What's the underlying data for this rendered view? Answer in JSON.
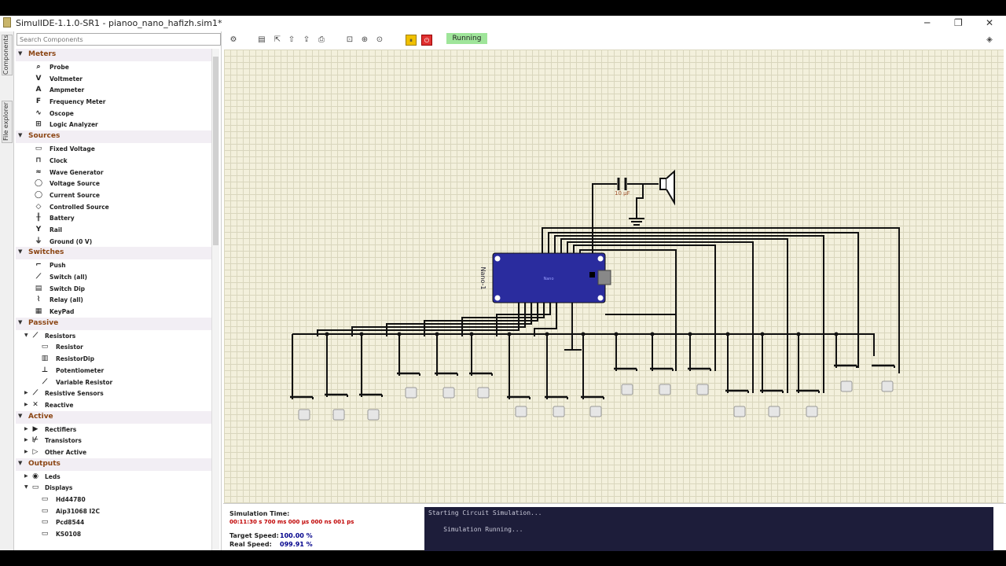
{
  "window": {
    "title": "SimulIDE-1.1.0-SR1 - pianoo_nano_hafizh.sim1*"
  },
  "left_tabs": [
    "Components",
    "File explorer"
  ],
  "search": {
    "placeholder": "Search Components"
  },
  "tree": [
    {
      "category": "Meters",
      "items": [
        {
          "label": "Probe",
          "icon": "probe-icon",
          "glyph": "⌕"
        },
        {
          "label": "Voltmeter",
          "icon": "voltmeter-icon",
          "glyph": "V"
        },
        {
          "label": "Ampmeter",
          "icon": "ampmeter-icon",
          "glyph": "A"
        },
        {
          "label": "Frequency Meter",
          "icon": "frequency-meter-icon",
          "glyph": "F"
        },
        {
          "label": "Oscope",
          "icon": "oscope-icon",
          "glyph": "∿"
        },
        {
          "label": "Logic Analyzer",
          "icon": "logic-analyzer-icon",
          "glyph": "⊞"
        }
      ]
    },
    {
      "category": "Sources",
      "items": [
        {
          "label": "Fixed Voltage",
          "icon": "fixed-voltage-icon",
          "glyph": "▭"
        },
        {
          "label": "Clock",
          "icon": "clock-icon",
          "glyph": "⊓"
        },
        {
          "label": "Wave Generator",
          "icon": "wave-generator-icon",
          "glyph": "≈"
        },
        {
          "label": "Voltage Source",
          "icon": "voltage-source-icon",
          "glyph": "◯"
        },
        {
          "label": "Current Source",
          "icon": "current-source-icon",
          "glyph": "◯"
        },
        {
          "label": "Controlled Source",
          "icon": "controlled-source-icon",
          "glyph": "◇"
        },
        {
          "label": "Battery",
          "icon": "battery-icon",
          "glyph": "╫"
        },
        {
          "label": "Rail",
          "icon": "rail-icon",
          "glyph": "Y"
        },
        {
          "label": "Ground (0 V)",
          "icon": "ground-icon",
          "glyph": "⏚"
        }
      ]
    },
    {
      "category": "Switches",
      "items": [
        {
          "label": "Push",
          "icon": "push-icon",
          "glyph": "⌐"
        },
        {
          "label": "Switch (all)",
          "icon": "switch-icon",
          "glyph": "⟋"
        },
        {
          "label": "Switch Dip",
          "icon": "switch-dip-icon",
          "glyph": "▤"
        },
        {
          "label": "Relay (all)",
          "icon": "relay-icon",
          "glyph": "⌇"
        },
        {
          "label": "KeyPad",
          "icon": "keypad-icon",
          "glyph": "▦"
        }
      ]
    },
    {
      "category": "Passive",
      "items": [
        {
          "label": "Resistors",
          "icon": "resistors-icon",
          "glyph": "⟋",
          "level": "sub",
          "arrow": "▼"
        },
        {
          "label": "Resistor",
          "icon": "resistor-icon",
          "glyph": "▭",
          "level": "sub2"
        },
        {
          "label": "ResistorDip",
          "icon": "resistor-dip-icon",
          "glyph": "▥",
          "level": "sub2"
        },
        {
          "label": "Potentiometer",
          "icon": "potentiometer-icon",
          "glyph": "⊥",
          "level": "sub2"
        },
        {
          "label": "Variable Resistor",
          "icon": "variable-resistor-icon",
          "glyph": "⟋",
          "level": "sub2"
        },
        {
          "label": "Resistive Sensors",
          "icon": "resistive-sensors-icon",
          "glyph": "⟋",
          "level": "sub",
          "arrow": "▶"
        },
        {
          "label": "Reactive",
          "icon": "reactive-icon",
          "glyph": "✕",
          "level": "sub",
          "arrow": "▶"
        }
      ]
    },
    {
      "category": "Active",
      "items": [
        {
          "label": "Rectifiers",
          "icon": "rectifiers-icon",
          "glyph": "▶",
          "level": "sub",
          "arrow": "▶"
        },
        {
          "label": "Transistors",
          "icon": "transistors-icon",
          "glyph": "⊬",
          "level": "sub",
          "arrow": "▶"
        },
        {
          "label": "Other Active",
          "icon": "other-active-icon",
          "glyph": "▷",
          "level": "sub",
          "arrow": "▶"
        }
      ]
    },
    {
      "category": "Outputs",
      "items": [
        {
          "label": "Leds",
          "icon": "leds-icon",
          "glyph": "◉",
          "level": "sub",
          "arrow": "▶"
        },
        {
          "label": "Displays",
          "icon": "displays-icon",
          "glyph": "▭",
          "level": "sub",
          "arrow": "▼"
        },
        {
          "label": "Hd44780",
          "icon": "hd44780-icon",
          "glyph": "▭",
          "level": "sub2"
        },
        {
          "label": "Aip31068 I2C",
          "icon": "aip31068-icon",
          "glyph": "▭",
          "level": "sub2"
        },
        {
          "label": "Pcd8544",
          "icon": "pcd8544-icon",
          "glyph": "▭",
          "level": "sub2"
        },
        {
          "label": "KS0108",
          "icon": "ks0108-icon",
          "glyph": "▭",
          "level": "sub2"
        }
      ]
    }
  ],
  "toolbar": {
    "running_label": "Running"
  },
  "circuit": {
    "capacitor_label": "10 µF",
    "board_label": "Nano-1",
    "board_text": "Nano"
  },
  "status": {
    "sim_time_label": "Simulation Time:",
    "sim_time_value": "00:11:30 s  700 ms  000 µs  000 ns  001 ps",
    "target_speed_label": "Target Speed:",
    "target_speed_value": "100.00 %",
    "real_speed_label": "Real Speed:",
    "real_speed_value": "099.91 %"
  },
  "console": [
    "Starting Circuit Simulation...",
    "    Simulation Running..."
  ]
}
